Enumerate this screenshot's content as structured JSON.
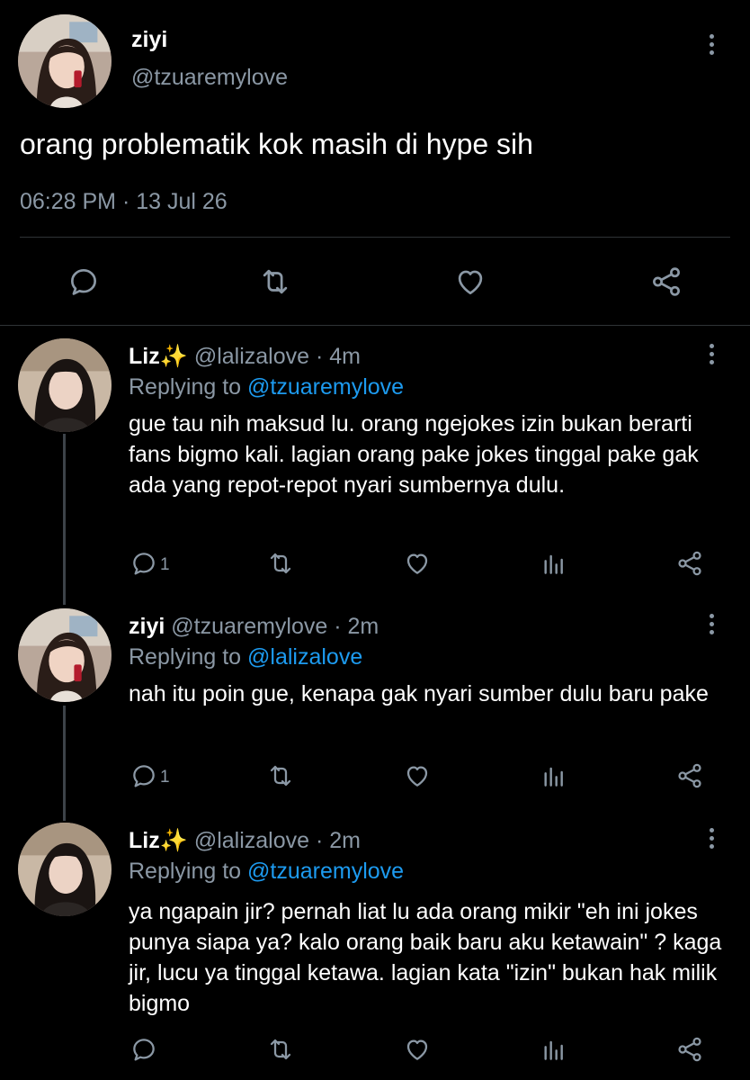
{
  "main_tweet": {
    "display_name": "ziyi",
    "handle": "@tzuaremylove",
    "text": "orang problematik kok masih di hype sih",
    "timestamp": "06:28 PM · 13 Jul 26",
    "icons": [
      "reply-icon",
      "retweet-icon",
      "like-icon",
      "share-icon",
      "more-icon"
    ]
  },
  "replies": [
    {
      "display_name": "Liz✨",
      "handle_time": "@lalizalove · 4m",
      "replying_prefix": "Replying to ",
      "replying_to": "@tzuaremylove",
      "text": "gue tau nih maksud lu. orang ngejokes izin bukan berarti fans bigmo kali. lagian orang pake jokes tinggal pake gak ada yang repot-repot nyari sumbernya dulu.",
      "reply_count": "1"
    },
    {
      "display_name": "ziyi",
      "handle_time": "@tzuaremylove · 2m",
      "replying_prefix": "Replying to ",
      "replying_to": "@lalizalove",
      "text": "nah itu poin gue, kenapa gak nyari sumber dulu baru pake",
      "reply_count": "1"
    },
    {
      "display_name": "Liz✨",
      "handle_time": "@lalizalove · 2m",
      "replying_prefix": "Replying to ",
      "replying_to": "@tzuaremylove",
      "text": "ya ngapain jir? pernah liat lu ada orang mikir \"eh ini jokes punya siapa ya? kalo orang baik baru aku ketawain\" ? kaga jir, lucu ya tinggal ketawa. lagian kata \"izin\" bukan hak milik bigmo",
      "reply_count": ""
    }
  ],
  "colors": {
    "background": "#000000",
    "secondary_text": "#8b98a5",
    "link": "#1d9bf0",
    "divider": "#2f3336"
  }
}
